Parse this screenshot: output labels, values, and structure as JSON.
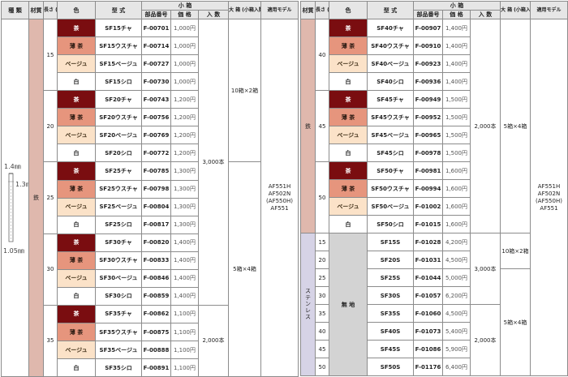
{
  "headers": {
    "kind": "種 類",
    "material": "材質",
    "length": "長さ (㎜)",
    "color": "色",
    "model": "型 式",
    "small_box": "小 箱",
    "part_no": "部品番号",
    "price": "価 格",
    "qty": "入 数",
    "big_box": "大 箱 (小箱入数)",
    "applicable": "適用モデル"
  },
  "staple": {
    "dim_top": "1.4㎜",
    "dim_side": "1.3㎜",
    "dim_bottom": "1.05㎜"
  },
  "left": {
    "material": "鉄",
    "qty_upper": "3,000本",
    "qty_lower": "2,000本",
    "pack_upper": "10箱×2箱",
    "pack_lower": "5箱×4箱",
    "models": [
      "AF551H",
      "AF502N",
      "(AF550H)",
      "AF551"
    ],
    "groups": [
      {
        "length": "15",
        "rows": [
          {
            "color": "茶",
            "model": "SF15チャ",
            "part": "F-00701",
            "price": "1,000円"
          },
          {
            "color": "薄 茶",
            "model": "SF15ウスチャ",
            "part": "F-00714",
            "price": "1,000円"
          },
          {
            "color": "ベージュ",
            "model": "SF15ベージュ",
            "part": "F-00727",
            "price": "1,000円"
          },
          {
            "color": "白",
            "model": "SF15シロ",
            "part": "F-00730",
            "price": "1,000円"
          }
        ]
      },
      {
        "length": "20",
        "rows": [
          {
            "color": "茶",
            "model": "SF20チャ",
            "part": "F-00743",
            "price": "1,200円"
          },
          {
            "color": "薄 茶",
            "model": "SF20ウスチャ",
            "part": "F-00756",
            "price": "1,200円"
          },
          {
            "color": "ベージュ",
            "model": "SF20ベージュ",
            "part": "F-00769",
            "price": "1,200円"
          },
          {
            "color": "白",
            "model": "SF20シロ",
            "part": "F-00772",
            "price": "1,200円"
          }
        ]
      },
      {
        "length": "25",
        "rows": [
          {
            "color": "茶",
            "model": "SF25チャ",
            "part": "F-00785",
            "price": "1,300円"
          },
          {
            "color": "薄 茶",
            "model": "SF25ウスチャ",
            "part": "F-00798",
            "price": "1,300円"
          },
          {
            "color": "ベージュ",
            "model": "SF25ベージュ",
            "part": "F-00804",
            "price": "1,300円"
          },
          {
            "color": "白",
            "model": "SF25シロ",
            "part": "F-00817",
            "price": "1,300円"
          }
        ]
      },
      {
        "length": "30",
        "rows": [
          {
            "color": "茶",
            "model": "SF30チャ",
            "part": "F-00820",
            "price": "1,400円"
          },
          {
            "color": "薄 茶",
            "model": "SF30ウスチャ",
            "part": "F-00833",
            "price": "1,400円"
          },
          {
            "color": "ベージュ",
            "model": "SF30ベージュ",
            "part": "F-00846",
            "price": "1,400円"
          },
          {
            "color": "白",
            "model": "SF30シロ",
            "part": "F-00859",
            "price": "1,400円"
          }
        ]
      },
      {
        "length": "35",
        "rows": [
          {
            "color": "茶",
            "model": "SF35チャ",
            "part": "F-00862",
            "price": "1,100円"
          },
          {
            "color": "薄 茶",
            "model": "SF35ウスチャ",
            "part": "F-00875",
            "price": "1,100円"
          },
          {
            "color": "ベージュ",
            "model": "SF35ベージュ",
            "part": "F-00888",
            "price": "1,100円"
          },
          {
            "color": "白",
            "model": "SF35シロ",
            "part": "F-00891",
            "price": "1,100円"
          }
        ]
      }
    ]
  },
  "right": {
    "material_iron": "鉄",
    "material_sus": "ステンレス",
    "qty_iron": "2,000本",
    "pack_iron": "5箱×4箱",
    "qty_sus_upper": "3,000本",
    "qty_sus_lower": "2,000本",
    "pack_sus_upper": "10箱×2箱",
    "pack_sus_lower": "5箱×4箱",
    "sus_color": "無 地",
    "models": [
      "AF551H",
      "AF502N",
      "(AF550H)",
      "AF551"
    ],
    "groups": [
      {
        "length": "40",
        "rows": [
          {
            "color": "茶",
            "model": "SF40チャ",
            "part": "F-00907",
            "price": "1,400円"
          },
          {
            "color": "薄 茶",
            "model": "SF40ウスチャ",
            "part": "F-00910",
            "price": "1,400円"
          },
          {
            "color": "ベージュ",
            "model": "SF40ベージュ",
            "part": "F-00923",
            "price": "1,400円"
          },
          {
            "color": "白",
            "model": "SF40シロ",
            "part": "F-00936",
            "price": "1,400円"
          }
        ]
      },
      {
        "length": "45",
        "rows": [
          {
            "color": "茶",
            "model": "SF45チャ",
            "part": "F-00949",
            "price": "1,500円"
          },
          {
            "color": "薄 茶",
            "model": "SF45ウスチャ",
            "part": "F-00952",
            "price": "1,500円"
          },
          {
            "color": "ベージュ",
            "model": "SF45ベージュ",
            "part": "F-00965",
            "price": "1,500円"
          },
          {
            "color": "白",
            "model": "SF45シロ",
            "part": "F-00978",
            "price": "1,500円"
          }
        ]
      },
      {
        "length": "50",
        "rows": [
          {
            "color": "茶",
            "model": "SF50チャ",
            "part": "F-00981",
            "price": "1,600円"
          },
          {
            "color": "薄 茶",
            "model": "SF50ウスチャ",
            "part": "F-00994",
            "price": "1,600円"
          },
          {
            "color": "ベージュ",
            "model": "SF50ベージュ",
            "part": "F-01002",
            "price": "1,600円"
          },
          {
            "color": "白",
            "model": "SF50シロ",
            "part": "F-01015",
            "price": "1,600円"
          }
        ]
      }
    ],
    "sus_rows": [
      {
        "length": "15",
        "model": "SF15S",
        "part": "F-01028",
        "price": "4,200円"
      },
      {
        "length": "20",
        "model": "SF20S",
        "part": "F-01031",
        "price": "4,500円"
      },
      {
        "length": "25",
        "model": "SF25S",
        "part": "F-01044",
        "price": "5,000円"
      },
      {
        "length": "30",
        "model": "SF30S",
        "part": "F-01057",
        "price": "6,200円"
      },
      {
        "length": "35",
        "model": "SF35S",
        "part": "F-01060",
        "price": "4,500円"
      },
      {
        "length": "40",
        "model": "SF40S",
        "part": "F-01073",
        "price": "5,400円"
      },
      {
        "length": "45",
        "model": "SF45S",
        "part": "F-01086",
        "price": "5,900円"
      },
      {
        "length": "50",
        "model": "SF50S",
        "part": "F-01176",
        "price": "6,400円"
      }
    ]
  },
  "colors": {
    "cha": "#7a0d10",
    "usucha": "#e6957d",
    "beige": "#fbe2c8",
    "iron": "#dfb8ad",
    "stainless": "#d6d3e6",
    "muji": "#d3d3d3"
  }
}
